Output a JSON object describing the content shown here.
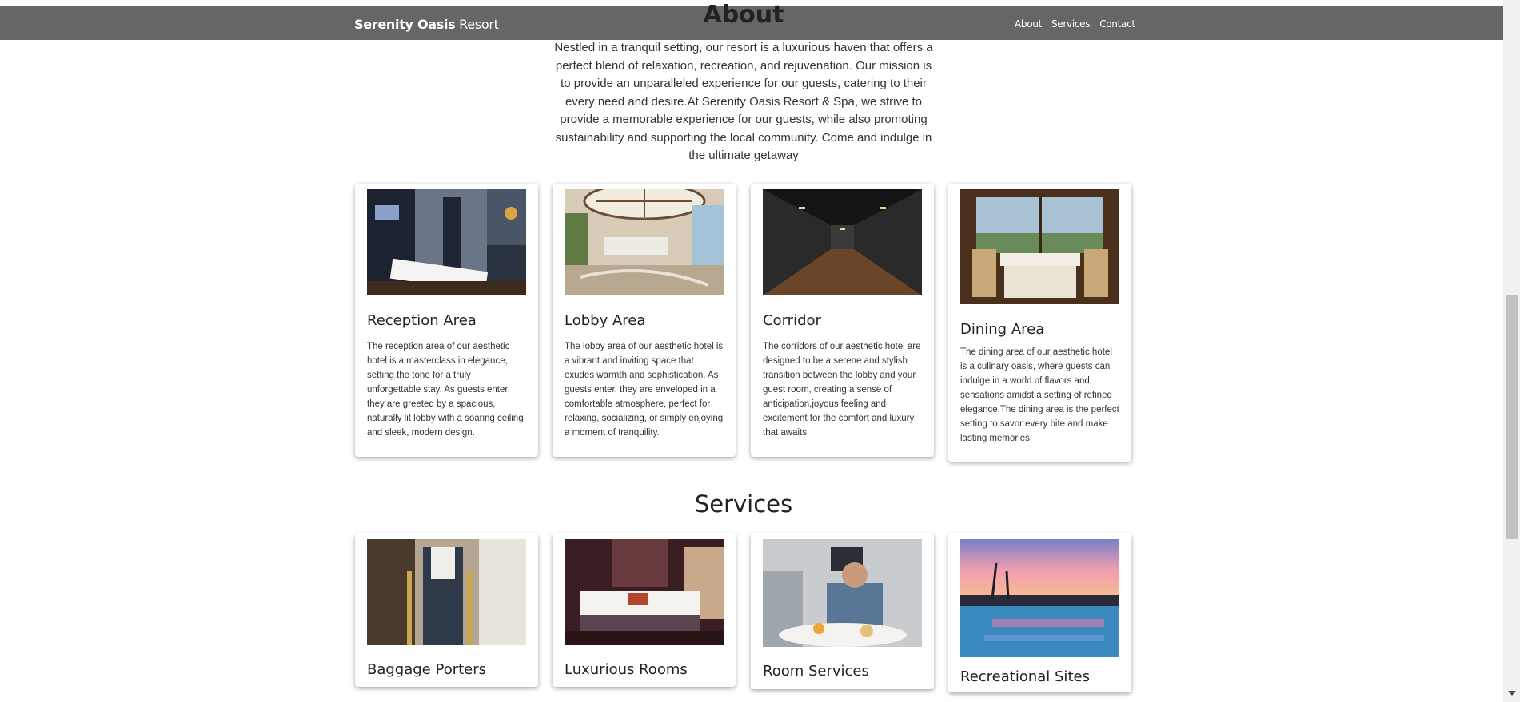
{
  "nav": {
    "brand_bold": "Serenity Oasis",
    "brand_rest": "Resort",
    "links": [
      "About",
      "Services",
      "Contact"
    ]
  },
  "about": {
    "title": "About",
    "text": "Nestled in a tranquil setting, our resort is a luxurious haven that offers a perfect blend of relaxation, recreation, and rejuvenation. Our mission is to provide an unparalleled experience for our guests, catering to their every need and desire.At Serenity Oasis Resort & Spa, we strive to provide a memorable experience for our guests, while also promoting sustainability and supporting the local community. Come and indulge in the ultimate getaway"
  },
  "about_cards": [
    {
      "title": "Reception Area",
      "text": "The reception area of our aesthetic hotel is a masterclass in elegance, setting the tone for a truly unforgettable stay. As guests enter, they are greeted by a spacious, naturally lit lobby with a soaring ceiling and sleek, modern design."
    },
    {
      "title": "Lobby Area",
      "text": "The lobby area of our aesthetic hotel is a vibrant and inviting space that exudes warmth and sophistication. As guests enter, they are enveloped in a comfortable atmosphere, perfect for relaxing, socializing, or simply enjoying a moment of tranquility."
    },
    {
      "title": "Corridor",
      "text": "The corridors of our aesthetic hotel are designed to be a serene and stylish transition between the lobby and your guest room, creating a sense of anticipation,joyous feeling and excitement for the comfort and luxury that awaits."
    },
    {
      "title": "Dining Area",
      "text": "The dining area of our aesthetic hotel is a culinary oasis, where guests can indulge in a world of flavors and sensations amidst a setting of refined elegance.The dining area is the perfect setting to savor every bite and make lasting memories."
    }
  ],
  "services": {
    "title": "Services",
    "cards": [
      {
        "title": "Baggage Porters"
      },
      {
        "title": "Luxurious Rooms"
      },
      {
        "title": "Room Services"
      },
      {
        "title": "Recreational Sites"
      }
    ]
  }
}
